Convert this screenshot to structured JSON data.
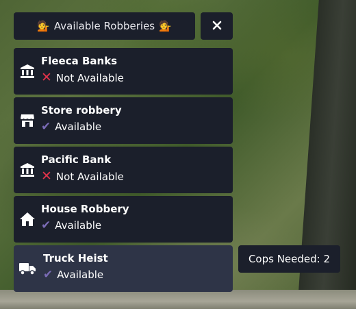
{
  "header": {
    "title": "Available Robberies",
    "emoji_left": "💁",
    "emoji_right": "💁"
  },
  "close_button": {
    "label": "✕"
  },
  "robberies": [
    {
      "title": "Fleeca Banks",
      "status": "Not Available",
      "available": false,
      "icon": "bank-icon"
    },
    {
      "title": "Store robbery",
      "status": "Available",
      "available": true,
      "icon": "store-icon"
    },
    {
      "title": "Pacific Bank",
      "status": "Not Available",
      "available": false,
      "icon": "bank-icon"
    },
    {
      "title": "House Robbery",
      "status": "Available",
      "available": true,
      "icon": "house-icon"
    },
    {
      "title": "Truck Heist",
      "status": "Available",
      "available": true,
      "icon": "truck-icon",
      "highlighted": true
    }
  ],
  "tooltip": {
    "text": "Cops Needed: 2"
  },
  "colors": {
    "card_bg": "#1b1f2b",
    "card_hover_bg": "#2e3447",
    "x_mark": "#e2334b",
    "check_mark": "#7a6bb5"
  }
}
